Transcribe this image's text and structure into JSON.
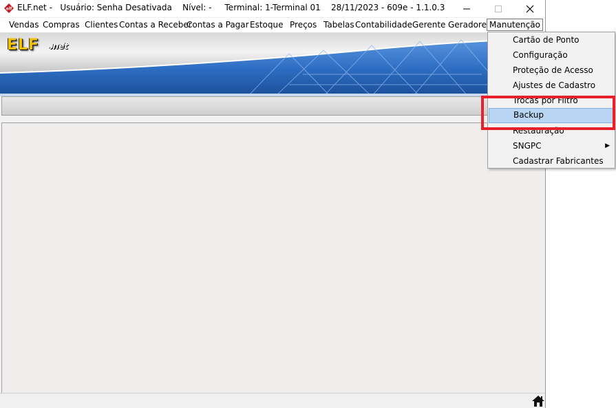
{
  "title_bar": {
    "title": "ELF.net -   Usuário: Senha Desativada    Nível: -     Terminal: 1-Terminal 01    28/11/2023 - 609e - 1.1.0.3",
    "icon": "elf-app-icon"
  },
  "window_controls": {
    "minimize_icon": "minimize-icon",
    "maximize_icon": "maximize-icon",
    "close_icon": "close-icon"
  },
  "menu": {
    "items": [
      "Vendas",
      "Compras",
      "Clientes",
      "Contas a Receber",
      "Contas a Pagar",
      "Estoque",
      "Preços",
      "Tabelas",
      "Contabilidade",
      "Gerente",
      "Geradores",
      "Manutenção"
    ]
  },
  "banner": {
    "logo_main": "ELF",
    "logo_sub": ".net"
  },
  "dropdown": {
    "items": [
      "Cartão de Ponto",
      "Configuração",
      "Proteção de Acesso",
      "Ajustes de Cadastro",
      "Trocas por Filtro",
      "Backup",
      "Restauração",
      "SNGPC",
      "Cadastrar Fabricantes"
    ],
    "selected": "Backup",
    "submenu_item": "SNGPC"
  },
  "colors": {
    "highlight": "#e8202a",
    "selection": "#b8d6f3",
    "banner_blue": "#2f6fc4",
    "logo_gold": "#f0c000"
  },
  "status_icon": "home-icon"
}
